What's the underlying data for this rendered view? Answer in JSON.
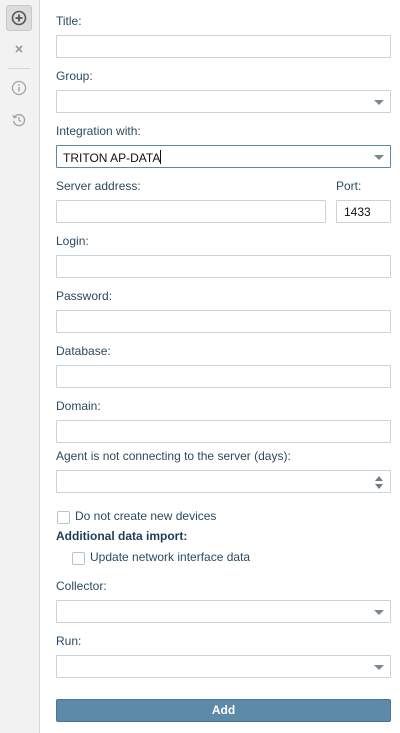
{
  "toolbar": {
    "add_icon": "plus-circle-icon",
    "close_icon": "close-icon",
    "info_icon": "info-icon",
    "history_icon": "history-icon"
  },
  "form": {
    "title_label": "Title:",
    "title_value": "",
    "group_label": "Group:",
    "group_value": "",
    "integration_label": "Integration with:",
    "integration_value": "TRITON AP-DATA",
    "server_label": "Server address:",
    "server_value": "",
    "port_label": "Port:",
    "port_value": "1433",
    "login_label": "Login:",
    "login_value": "",
    "password_label": "Password:",
    "password_value": "",
    "database_label": "Database:",
    "database_value": "",
    "domain_label": "Domain:",
    "domain_value": "",
    "agent_label": "Agent is not connecting to the server (days):",
    "agent_value": "",
    "no_new_devices_label": "Do not create new devices",
    "no_new_devices_checked": false,
    "additional_import_heading": "Additional data import:",
    "update_network_label": "Update network interface data",
    "update_network_checked": false,
    "collector_label": "Collector:",
    "collector_value": "",
    "run_label": "Run:",
    "run_value": "",
    "add_label": "Add"
  },
  "colors": {
    "accent": "#5d8aa8",
    "label_text": "#2c4a63",
    "field_border": "#c9d3dc"
  }
}
